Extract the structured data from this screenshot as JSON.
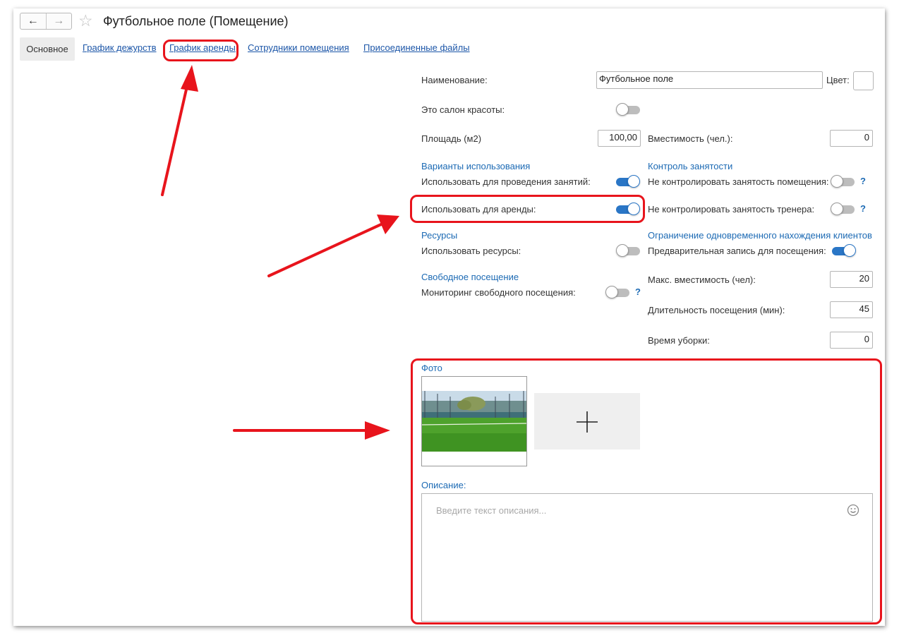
{
  "header": {
    "back_icon": "arrow-left-icon",
    "forward_icon": "arrow-right-icon",
    "favorite_icon": "star-icon",
    "title": "Футбольное поле (Помещение)"
  },
  "tabs": [
    {
      "label": "Основное",
      "active": true
    },
    {
      "label": "График дежурств"
    },
    {
      "label": "График аренды"
    },
    {
      "label": "Сотрудники помещения"
    },
    {
      "label": "Присоединенные файлы"
    }
  ],
  "form": {
    "name_label": "Наименование:",
    "name_value": "Футбольное поле",
    "color_label": "Цвет:",
    "beauty_salon_label": "Это салон красоты:",
    "area_label": "Площадь (м2)",
    "area_value": "100,00",
    "capacity_label": "Вместимость (чел.):",
    "capacity_value": "0",
    "usage_section": "Варианты использования",
    "use_classes_label": "Использовать для проведения занятий:",
    "use_rent_label": "Использовать для аренды:",
    "resources_section": "Ресурсы",
    "use_resources_label": "Использовать ресурсы:",
    "free_visit_section": "Свободное посещение",
    "free_visit_monitor_label": "Мониторинг свободного посещения:",
    "occupancy_section": "Контроль занятости",
    "no_room_control_label": "Не контролировать занятость помещения:",
    "no_trainer_control_label": "Не контролировать занятость тренера:",
    "limit_section": "Ограничение одновременного нахождения клиентов",
    "prebooking_label": "Предварительная запись для посещения:",
    "max_capacity_label": "Макс. вместимость (чел):",
    "max_capacity_value": "20",
    "visit_duration_label": "Длительность посещения (мин):",
    "visit_duration_value": "45",
    "cleaning_time_label": "Время уборки:",
    "cleaning_time_value": "0",
    "help_mark": "?",
    "toggles": {
      "beauty_salon": false,
      "use_classes": true,
      "use_rent": true,
      "use_resources": false,
      "free_visit_monitor": false,
      "no_room_control": false,
      "no_trainer_control": false,
      "prebooking": true
    },
    "photo_section": "Фото",
    "add_photo_icon": "plus-icon",
    "description_section": "Описание:",
    "description_placeholder": "Введите текст описания...",
    "emoji_icon": "smiley-icon"
  },
  "annotation_color": "#e8141c",
  "accent_color": "#2a76c6"
}
